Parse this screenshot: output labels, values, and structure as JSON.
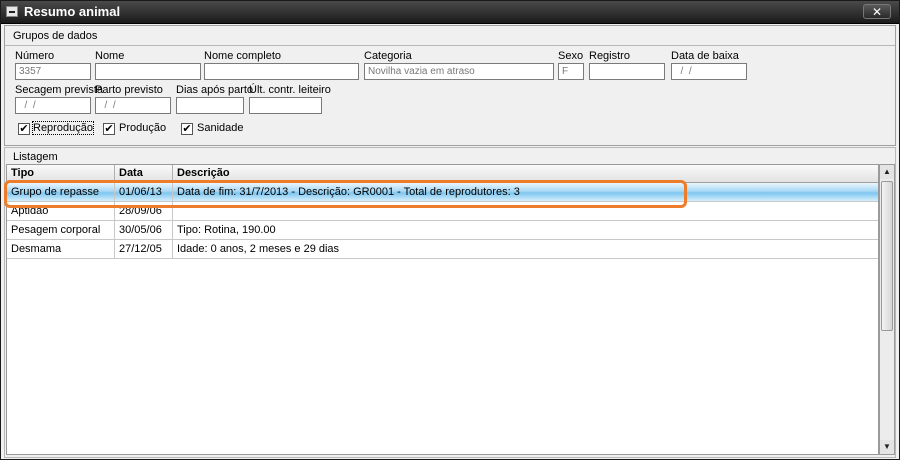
{
  "window": {
    "title": "Resumo animal",
    "close_glyph": "✕"
  },
  "groups": {
    "legend": "Grupos de dados",
    "fields": {
      "numero": {
        "label": "Número",
        "value": "3357"
      },
      "nome": {
        "label": "Nome",
        "value": ""
      },
      "nome_completo": {
        "label": "Nome completo",
        "value": ""
      },
      "categoria": {
        "label": "Categoria",
        "value": "Novilha vazia em atraso"
      },
      "sexo": {
        "label": "Sexo",
        "value": "F"
      },
      "registro": {
        "label": "Registro",
        "value": ""
      },
      "data_baixa": {
        "label": "Data de baixa",
        "value": "  /  /"
      },
      "secagem": {
        "label": "Secagem prevista",
        "value": "  /  /"
      },
      "parto": {
        "label": "Parto previsto",
        "value": "  /  /"
      },
      "dias": {
        "label": "Dias após parto",
        "value": ""
      },
      "ult": {
        "label": "Últ. contr. leiteiro",
        "value": ""
      }
    },
    "checkboxes": [
      {
        "label": "Reprodução",
        "checked": true
      },
      {
        "label": "Produção",
        "checked": true
      },
      {
        "label": "Sanidade",
        "checked": true
      }
    ],
    "check_glyph": "✔"
  },
  "list": {
    "legend": "Listagem",
    "columns": [
      "Tipo",
      "Data",
      "Descrição"
    ],
    "rows": [
      {
        "tipo": "Grupo de repasse",
        "data": "01/06/13",
        "descricao": "Data de fim: 31/7/2013 - Descrição: GR0001 - Total de reprodutores: 3"
      },
      {
        "tipo": "Aptidão",
        "data": "28/09/06",
        "descricao": ""
      },
      {
        "tipo": "Pesagem corporal",
        "data": "30/05/06",
        "descricao": "Tipo: Rotina, 190.00"
      },
      {
        "tipo": "Desmama",
        "data": "27/12/05",
        "descricao": "Idade: 0 anos, 2 meses e 29 dias"
      }
    ]
  },
  "scroll": {
    "up_glyph": "▲",
    "down_glyph": "▼"
  },
  "colors": {
    "highlight": "#ee7d2b",
    "selected_row": "#7ec6ef",
    "titlebar": "#2a2a2a"
  }
}
